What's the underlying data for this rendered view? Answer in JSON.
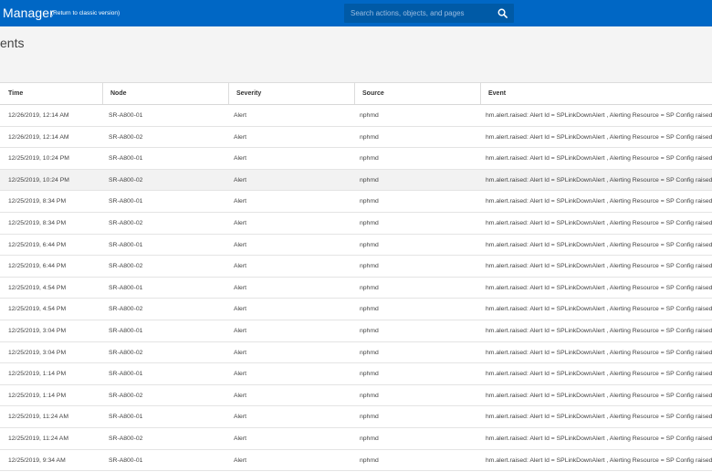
{
  "header": {
    "app_title": "Manager",
    "classic_link": "(Return to classic version)",
    "search_placeholder": "Search actions, objects, and pages"
  },
  "page": {
    "title": "ents"
  },
  "table": {
    "columns": [
      "Time",
      "Node",
      "Severity",
      "Source",
      "Event"
    ],
    "rows": [
      {
        "time": "12/26/2019, 12:14 AM",
        "node": "SR-A800-01",
        "severity": "Alert",
        "source": "nphmd",
        "event": "hm.alert.raised: Alert Id = SPLinkDownAlert , Alerting Resource = SP Config raised"
      },
      {
        "time": "12/26/2019, 12:14 AM",
        "node": "SR-A800-02",
        "severity": "Alert",
        "source": "nphmd",
        "event": "hm.alert.raised: Alert Id = SPLinkDownAlert , Alerting Resource = SP Config raised"
      },
      {
        "time": "12/25/2019, 10:24 PM",
        "node": "SR-A800-01",
        "severity": "Alert",
        "source": "nphmd",
        "event": "hm.alert.raised: Alert Id = SPLinkDownAlert , Alerting Resource = SP Config raised"
      },
      {
        "time": "12/25/2019, 10:24 PM",
        "node": "SR-A800-02",
        "severity": "Alert",
        "source": "nphmd",
        "event": "hm.alert.raised: Alert Id = SPLinkDownAlert , Alerting Resource = SP Config raised"
      },
      {
        "time": "12/25/2019, 8:34 PM",
        "node": "SR-A800-01",
        "severity": "Alert",
        "source": "nphmd",
        "event": "hm.alert.raised: Alert Id = SPLinkDownAlert , Alerting Resource = SP Config raised"
      },
      {
        "time": "12/25/2019, 8:34 PM",
        "node": "SR-A800-02",
        "severity": "Alert",
        "source": "nphmd",
        "event": "hm.alert.raised: Alert Id = SPLinkDownAlert , Alerting Resource = SP Config raised"
      },
      {
        "time": "12/25/2019, 6:44 PM",
        "node": "SR-A800-01",
        "severity": "Alert",
        "source": "nphmd",
        "event": "hm.alert.raised: Alert Id = SPLinkDownAlert , Alerting Resource = SP Config raised"
      },
      {
        "time": "12/25/2019, 6:44 PM",
        "node": "SR-A800-02",
        "severity": "Alert",
        "source": "nphmd",
        "event": "hm.alert.raised: Alert Id = SPLinkDownAlert , Alerting Resource = SP Config raised"
      },
      {
        "time": "12/25/2019, 4:54 PM",
        "node": "SR-A800-01",
        "severity": "Alert",
        "source": "nphmd",
        "event": "hm.alert.raised: Alert Id = SPLinkDownAlert , Alerting Resource = SP Config raised"
      },
      {
        "time": "12/25/2019, 4:54 PM",
        "node": "SR-A800-02",
        "severity": "Alert",
        "source": "nphmd",
        "event": "hm.alert.raised: Alert Id = SPLinkDownAlert , Alerting Resource = SP Config raised"
      },
      {
        "time": "12/25/2019, 3:04 PM",
        "node": "SR-A800-01",
        "severity": "Alert",
        "source": "nphmd",
        "event": "hm.alert.raised: Alert Id = SPLinkDownAlert , Alerting Resource = SP Config raised"
      },
      {
        "time": "12/25/2019, 3:04 PM",
        "node": "SR-A800-02",
        "severity": "Alert",
        "source": "nphmd",
        "event": "hm.alert.raised: Alert Id = SPLinkDownAlert , Alerting Resource = SP Config raised"
      },
      {
        "time": "12/25/2019, 1:14 PM",
        "node": "SR-A800-01",
        "severity": "Alert",
        "source": "nphmd",
        "event": "hm.alert.raised: Alert Id = SPLinkDownAlert , Alerting Resource = SP Config raised"
      },
      {
        "time": "12/25/2019, 1:14 PM",
        "node": "SR-A800-02",
        "severity": "Alert",
        "source": "nphmd",
        "event": "hm.alert.raised: Alert Id = SPLinkDownAlert , Alerting Resource = SP Config raised"
      },
      {
        "time": "12/25/2019, 11:24 AM",
        "node": "SR-A800-01",
        "severity": "Alert",
        "source": "nphmd",
        "event": "hm.alert.raised: Alert Id = SPLinkDownAlert , Alerting Resource = SP Config raised"
      },
      {
        "time": "12/25/2019, 11:24 AM",
        "node": "SR-A800-02",
        "severity": "Alert",
        "source": "nphmd",
        "event": "hm.alert.raised: Alert Id = SPLinkDownAlert , Alerting Resource = SP Config raised"
      },
      {
        "time": "12/25/2019, 9:34 AM",
        "node": "SR-A800-01",
        "severity": "Alert",
        "source": "nphmd",
        "event": "hm.alert.raised: Alert Id = SPLinkDownAlert , Alerting Resource = SP Config raised"
      }
    ]
  },
  "colors": {
    "topbar": "#0067c5",
    "search_bg": "#005aa6",
    "page_bg": "#f4f4f4",
    "row_alt": "#f2f2f2"
  }
}
